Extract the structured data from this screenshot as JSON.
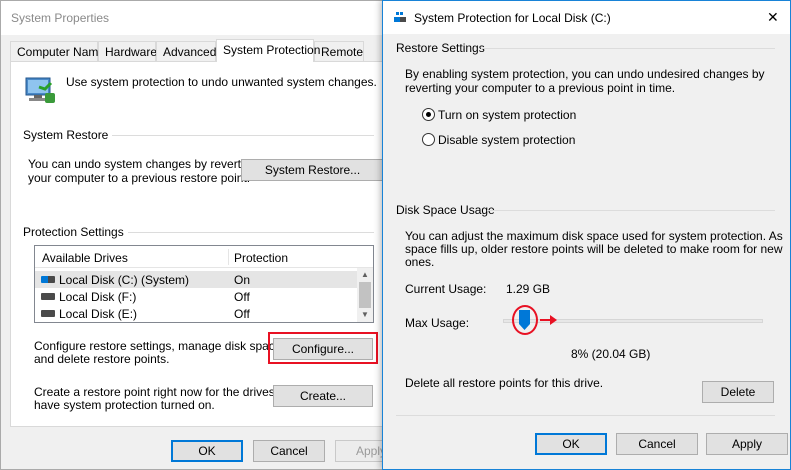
{
  "system_properties": {
    "title": "System Properties",
    "tabs": [
      "Computer Name",
      "Hardware",
      "Advanced",
      "System Protection",
      "Remote"
    ],
    "active_tab": "System Protection",
    "intro_text": "Use system protection to undo unwanted system changes.",
    "system_restore": {
      "label": "System Restore",
      "description_line1": "You can undo system changes by reverting",
      "description_line2": "your computer to a previous restore point.",
      "button": "System Restore..."
    },
    "protection_settings": {
      "label": "Protection Settings",
      "columns": [
        "Available Drives",
        "Protection"
      ],
      "drives": [
        {
          "name": "Local Disk (C:) (System)",
          "protection": "On",
          "icon": "system-drive-icon"
        },
        {
          "name": "Local Disk (F:)",
          "protection": "Off",
          "icon": "drive-icon"
        },
        {
          "name": "Local Disk (E:)",
          "protection": "Off",
          "icon": "drive-icon"
        }
      ],
      "configure_text_line1": "Configure restore settings, manage disk space,",
      "configure_text_line2": "and delete restore points.",
      "configure_button": "Configure...",
      "create_text_line1": "Create a restore point right now for the drives that",
      "create_text_line2": "have system protection turned on.",
      "create_button": "Create..."
    },
    "footer": {
      "ok": "OK",
      "cancel": "Cancel",
      "apply": "Apply"
    }
  },
  "dialog": {
    "title": "System Protection for Local Disk (C:)",
    "close_glyph": "✕",
    "restore_settings": {
      "label": "Restore Settings",
      "description_line1": "By enabling system protection, you can undo undesired changes by",
      "description_line2": "reverting your computer to a previous point in time.",
      "option_on": "Turn on system protection",
      "option_off": "Disable system protection",
      "selected": "on"
    },
    "disk_space": {
      "label": "Disk Space Usage",
      "description_line1": "You can adjust the maximum disk space used for system protection. As",
      "description_line2": "space fills up, older restore points will be deleted to make room for new",
      "description_line3": "ones.",
      "current_usage_label": "Current Usage:",
      "current_usage_value": "1.29 GB",
      "max_usage_label": "Max Usage:",
      "max_usage_value": "8% (20.04 GB)",
      "max_usage_percent": 8,
      "delete_text": "Delete all restore points for this drive.",
      "delete_button": "Delete"
    },
    "footer": {
      "ok": "OK",
      "cancel": "Cancel",
      "apply": "Apply"
    }
  },
  "colors": {
    "accent": "#0078d7",
    "highlight": "#e81123"
  }
}
